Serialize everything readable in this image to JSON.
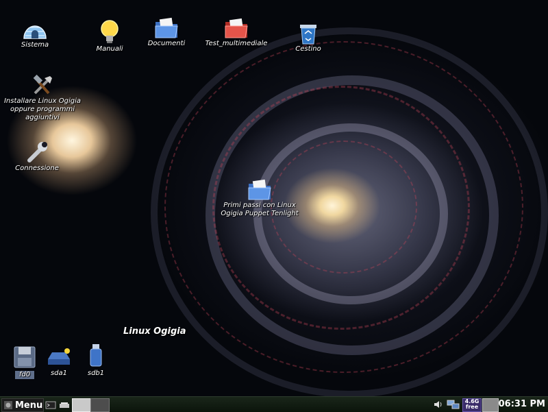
{
  "desktop": {
    "icons": [
      {
        "name": "sistema",
        "label": "Sistema"
      },
      {
        "name": "manuali",
        "label": "Manuali"
      },
      {
        "name": "documenti",
        "label": "Documenti"
      },
      {
        "name": "test_multimediale",
        "label": "Test_multimediale"
      },
      {
        "name": "cestino",
        "label": "Cestino"
      },
      {
        "name": "installare",
        "label": "Installare Linux Ogigia oppure programmi aggiuntivi"
      },
      {
        "name": "connessione",
        "label": "Connessione"
      },
      {
        "name": "primi_passi",
        "label": "Primi passi con Linux Ogigia Puppet Tenlight"
      }
    ],
    "brand_text": "Linux Ogigia",
    "drives": [
      {
        "label": "fd0"
      },
      {
        "label": "sda1"
      },
      {
        "label": "sdb1"
      }
    ]
  },
  "taskbar": {
    "menu_label": "Menu",
    "memory_line1": "4.6G",
    "memory_line2": "free",
    "clock": "06:31 PM"
  },
  "colors": {
    "taskbar": "#0f1a0f",
    "folder_blue": "#4a7fd0",
    "folder_red": "#d8443a",
    "selected_label": "#5f6f8c"
  }
}
